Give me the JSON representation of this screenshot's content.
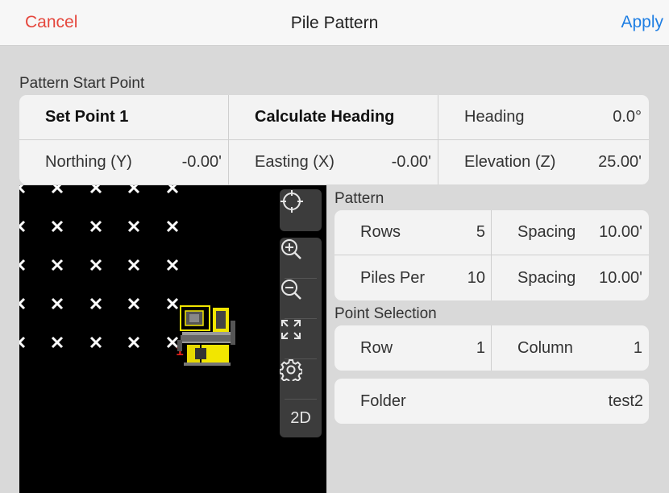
{
  "header": {
    "cancel_label": "Cancel",
    "title": "Pile Pattern",
    "apply_label": "Apply"
  },
  "start_point": {
    "section_label": "Pattern Start Point",
    "set_point_label": "Set Point 1",
    "calculate_heading_label": "Calculate Heading",
    "heading_label": "Heading",
    "heading_value": "0.0°",
    "northing_label": "Northing (Y)",
    "northing_value": "-0.00'",
    "easting_label": "Easting (X)",
    "easting_value": "-0.00'",
    "elevation_label": "Elevation (Z)",
    "elevation_value": "25.00'"
  },
  "pattern": {
    "section_label": "Pattern",
    "rows_label": "Rows",
    "rows_value": "5",
    "row_spacing_label": "Spacing",
    "row_spacing_value": "10.00'",
    "piles_per_label": "Piles Per",
    "piles_per_value": "10",
    "pile_spacing_label": "Spacing",
    "pile_spacing_value": "10.00'"
  },
  "point_selection": {
    "section_label": "Point Selection",
    "row_label": "Row",
    "row_value": "1",
    "column_label": "Column",
    "column_value": "1"
  },
  "folder": {
    "label": "Folder",
    "value": "test2"
  },
  "map": {
    "selected_pile_label": "1",
    "marker_color": "#ffffff",
    "machine_color": "#f2e600",
    "selected_label_color": "#e0201a"
  },
  "toolbar": {
    "recenter_icon": "crosshair-icon",
    "zoom_in_icon": "zoom-in-icon",
    "zoom_out_icon": "zoom-out-icon",
    "fit_icon": "expand-icon",
    "settings_icon": "gear-icon",
    "view_mode_label": "2D"
  },
  "colors": {
    "cancel": "#e5473d",
    "apply": "#1e7ee3",
    "background": "#d9d9d9",
    "panel": "#f3f3f3"
  }
}
